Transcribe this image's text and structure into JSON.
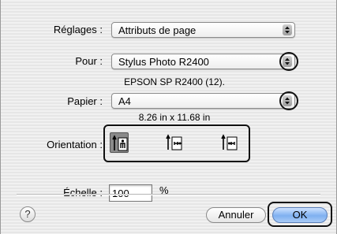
{
  "dialog": {
    "settings": {
      "label": "Réglages :",
      "value": "Attributs de page"
    },
    "format_for": {
      "label": "Pour :",
      "value": "Stylus Photo R2400",
      "description": "EPSON SP R2400 (12)."
    },
    "paper": {
      "label": "Papier :",
      "value": "A4",
      "dimensions": "8.26 in x 11.68 in"
    },
    "orientation": {
      "label": "Orientation :",
      "options": [
        {
          "name": "portrait",
          "selected": true
        },
        {
          "name": "landscape-left",
          "selected": false
        },
        {
          "name": "landscape-right",
          "selected": false
        }
      ]
    },
    "scale": {
      "label": "Échelle :",
      "value": "100",
      "unit": "%"
    },
    "help_glyph": "?",
    "buttons": {
      "cancel": "Annuler",
      "ok": "OK"
    }
  },
  "colors": {
    "default_button": "#7fb0f0",
    "highlight_marker": "#111111",
    "selected_orientation": "#8a8a8a"
  }
}
